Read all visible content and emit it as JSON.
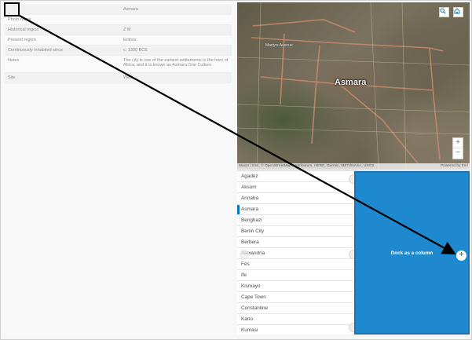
{
  "attributes": [
    {
      "key": "",
      "value": "Asmara"
    },
    {
      "key": "Photo name",
      "value": ""
    },
    {
      "key": "Historical region",
      "value": "Z M"
    },
    {
      "key": "Present region",
      "value": "Eritrea"
    },
    {
      "key": "Continuously inhabited since",
      "value": "c. 1300 BCE"
    },
    {
      "key": "Notes",
      "value": "The city is one of the earliest settlements in the horn of Africa, and it is known as Asmara One Culture"
    },
    {
      "key": "Site",
      "value": "Web"
    }
  ],
  "map": {
    "city_label": "Asmara",
    "street_labels": [
      "Martyrs Avenue"
    ],
    "attribution_left": "Maxar | Esri, © OpenStreetMap contributors, HERE, Garmin, METI/NASA, USGS",
    "attribution_right": "Powered by Esri",
    "zoom_in": "+",
    "zoom_out": "−",
    "search_icon": "search-icon",
    "home_icon": "home-icon"
  },
  "cities": [
    {
      "name": "Agadez",
      "selected": false
    },
    {
      "name": "Aksum",
      "selected": false
    },
    {
      "name": "Annaba",
      "selected": false
    },
    {
      "name": "Asmara",
      "selected": true
    },
    {
      "name": "Benghazi",
      "selected": false
    },
    {
      "name": "Benin City",
      "selected": false
    },
    {
      "name": "Berbera",
      "selected": false
    },
    {
      "name": "Alexandria",
      "selected": false
    },
    {
      "name": "Fès",
      "selected": false
    },
    {
      "name": "Ife",
      "selected": false
    },
    {
      "name": "Kismayo",
      "selected": false
    },
    {
      "name": "Cape Town",
      "selected": false
    },
    {
      "name": "Constantine",
      "selected": false
    },
    {
      "name": "Kano",
      "selected": false
    },
    {
      "name": "Kumasi",
      "selected": false
    }
  ],
  "dock": {
    "label": "Dock as a column",
    "plus": "+"
  },
  "colors": {
    "accent": "#0079c1",
    "dock_fill": "#1f89d0"
  }
}
